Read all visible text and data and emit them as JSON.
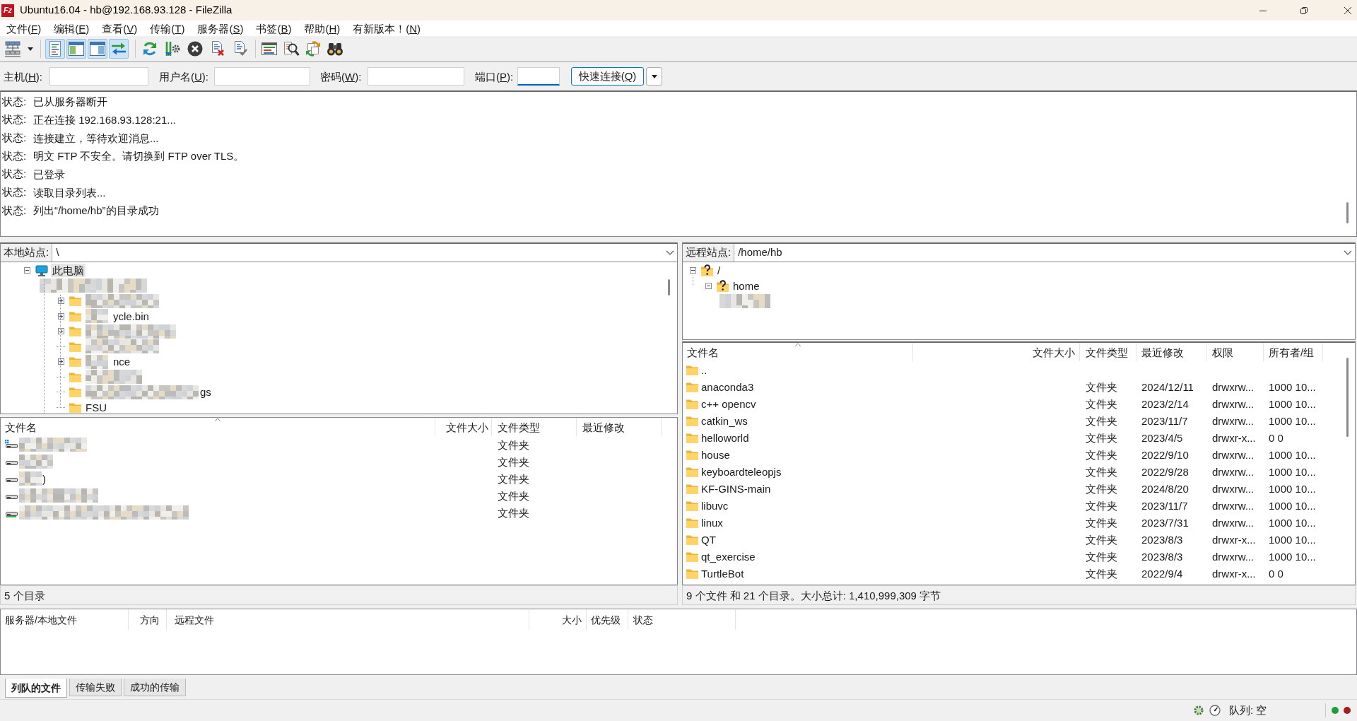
{
  "window": {
    "logo": "Fz",
    "title": "Ubuntu16.04 - hb@192.168.93.128 - FileZilla"
  },
  "menu": [
    "文件(F)",
    "编辑(E)",
    "查看(V)",
    "传输(T)",
    "服务器(S)",
    "书签(B)",
    "帮助(H)",
    "有新版本！(N)"
  ],
  "toolbar": {
    "toggles": [
      {
        "pressed": true
      },
      {
        "pressed": true
      },
      {
        "pressed": true
      },
      {
        "pressed": true
      }
    ]
  },
  "quickconnect": {
    "fields": [
      {
        "label": "主机(H):",
        "focused": false
      },
      {
        "label": "用户名(U):",
        "focused": false
      },
      {
        "label": "密码(W):",
        "focused": false
      },
      {
        "label": "端口(P):",
        "focused": true
      }
    ],
    "button": "快速连接(Q)"
  },
  "log": [
    {
      "label": "状态:",
      "message": "已从服务器断开"
    },
    {
      "label": "状态:",
      "message": "正在连接 192.168.93.128:21..."
    },
    {
      "label": "状态:",
      "message": "连接建立，等待欢迎消息..."
    },
    {
      "label": "状态:",
      "message": "明文 FTP 不安全。请切换到 FTP over TLS。"
    },
    {
      "label": "状态:",
      "message": "已登录"
    },
    {
      "label": "状态:",
      "message": "读取目录列表..."
    },
    {
      "label": "状态:",
      "message": "列出“/home/hb”的目录成功"
    }
  ],
  "local": {
    "site_label": "本地站点:",
    "path": "\\",
    "tree": {
      "kind": "computer",
      "label": "此电脑",
      "selected": true,
      "expanded": true,
      "children": [
        {
          "blurred": true,
          "children": [
            {
              "kind": "folder",
              "has_children": true,
              "blurred": true
            },
            {
              "kind": "folder",
              "has_children": true,
              "blurred": true,
              "label": "ycle.bin",
              "selected": false
            },
            {
              "kind": "folder",
              "has_children": true,
              "blurred": true
            },
            {
              "kind": "folder",
              "has_children": false,
              "blurred": true
            },
            {
              "kind": "folder",
              "has_children": true,
              "blurred": true,
              "label": "nce",
              "selected": false
            },
            {
              "kind": "folder",
              "has_children": false,
              "blurred": true
            },
            {
              "kind": "folder",
              "has_children": false,
              "blurred": true,
              "label": "gs",
              "selected": false
            },
            {
              "kind": "folder",
              "has_children": false,
              "blurred": false,
              "label": "FSU",
              "selected": false
            }
          ]
        }
      ]
    },
    "columns": [
      {
        "label": "文件名",
        "sorted": true
      },
      {
        "label": "文件大小",
        "sorted": false
      },
      {
        "label": "文件类型",
        "sorted": false
      },
      {
        "label": "最近修改",
        "sorted": false
      }
    ],
    "rows": [
      {
        "kind": "system",
        "blurred": true,
        "type": "文件夹"
      },
      {
        "kind": "drive",
        "blurred": true,
        "type": "文件夹"
      },
      {
        "kind": "drive",
        "blurred": true,
        "name": ")",
        "type": "文件夹"
      },
      {
        "kind": "drive",
        "blurred": true,
        "type": "文件夹"
      },
      {
        "kind": "removable",
        "blurred": true,
        "type": "文件夹"
      }
    ],
    "status": "5 个目录"
  },
  "remote": {
    "site_label": "远程站点:",
    "path": "/home/hb",
    "tree": {
      "kind": "unknown",
      "label": "/",
      "selected": false,
      "expanded": true,
      "children": [
        {
          "kind": "unknown",
          "label": "home",
          "selected": false,
          "expanded": true,
          "children": [
            {
              "blurred": true
            }
          ]
        }
      ]
    },
    "columns": [
      {
        "label": "文件名",
        "sorted": true
      },
      {
        "label": "文件大小",
        "sorted": false
      },
      {
        "label": "文件类型",
        "sorted": false
      },
      {
        "label": "最近修改",
        "sorted": false
      },
      {
        "label": "权限",
        "sorted": false
      },
      {
        "label": "所有者/组",
        "sorted": false
      }
    ],
    "rows": [
      {
        "name": ".."
      },
      {
        "name": "anaconda3",
        "type": "文件夹",
        "modified": "2024/12/11",
        "permissions": "drwxrw...",
        "owner": "1000 10..."
      },
      {
        "name": "c++ opencv",
        "type": "文件夹",
        "modified": "2023/2/14",
        "permissions": "drwxrw...",
        "owner": "1000 10..."
      },
      {
        "name": "catkin_ws",
        "type": "文件夹",
        "modified": "2023/11/7",
        "permissions": "drwxrw...",
        "owner": "1000 10..."
      },
      {
        "name": "helloworld",
        "type": "文件夹",
        "modified": "2023/4/5",
        "permissions": "drwxr-x...",
        "owner": "0 0"
      },
      {
        "name": "house",
        "type": "文件夹",
        "modified": "2022/9/10",
        "permissions": "drwxrw...",
        "owner": "1000 10..."
      },
      {
        "name": "keyboardteleopjs",
        "type": "文件夹",
        "modified": "2022/9/28",
        "permissions": "drwxrw...",
        "owner": "1000 10..."
      },
      {
        "name": "KF-GINS-main",
        "type": "文件夹",
        "modified": "2024/8/20",
        "permissions": "drwxrw...",
        "owner": "1000 10..."
      },
      {
        "name": "libuvc",
        "type": "文件夹",
        "modified": "2023/11/7",
        "permissions": "drwxrw...",
        "owner": "1000 10..."
      },
      {
        "name": "linux",
        "type": "文件夹",
        "modified": "2023/7/31",
        "permissions": "drwxrw...",
        "owner": "1000 10..."
      },
      {
        "name": "QT",
        "type": "文件夹",
        "modified": "2023/8/3",
        "permissions": "drwxr-x...",
        "owner": "1000 10..."
      },
      {
        "name": "qt_exercise",
        "type": "文件夹",
        "modified": "2023/8/3",
        "permissions": "drwxrw...",
        "owner": "1000 10..."
      },
      {
        "name": "TurtleBot",
        "type": "文件夹",
        "modified": "2022/9/4",
        "permissions": "drwxr-x...",
        "owner": "0 0"
      }
    ],
    "status": "9 个文件 和 21 个目录。大小总计: 1,410,999,309 字节"
  },
  "queue": {
    "columns": [
      "服务器/本地文件",
      "方向",
      "远程文件",
      "大小",
      "优先级",
      "状态"
    ],
    "tabs": [
      {
        "label": "列队的文件",
        "selected": true
      },
      {
        "label": "传输失败",
        "selected": false
      },
      {
        "label": "成功的传输",
        "selected": false
      }
    ]
  },
  "status_bar": {
    "queue": "队列: 空",
    "lights": [
      {
        "color": "#1f9d3a"
      },
      {
        "color": "#a31f1f"
      }
    ]
  }
}
